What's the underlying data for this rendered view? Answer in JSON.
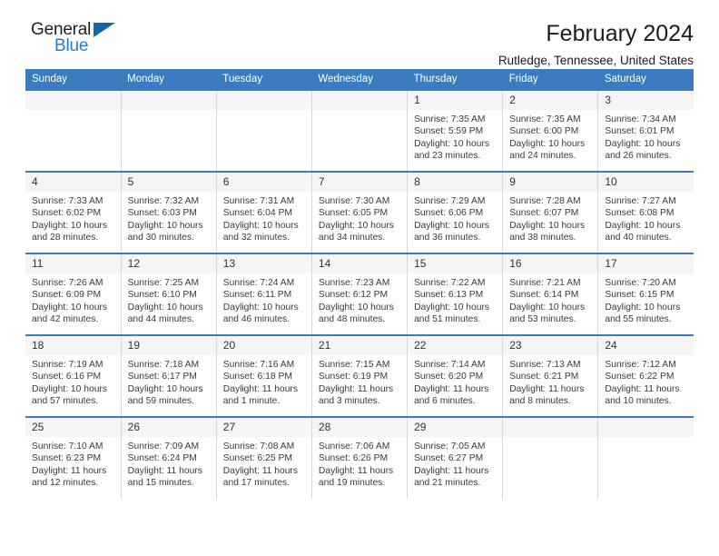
{
  "brand": {
    "word1": "General",
    "word2": "Blue",
    "triangle_color": "#1565a8",
    "blue_color": "#1f7fc6"
  },
  "header": {
    "title": "February 2024",
    "subtitle": "Rutledge, Tennessee, United States",
    "header_bg": "#3a7cbe"
  },
  "calendar": {
    "weekdays": [
      "Sunday",
      "Monday",
      "Tuesday",
      "Wednesday",
      "Thursday",
      "Friday",
      "Saturday"
    ],
    "weeks": [
      [
        {
          "day": "",
          "sunrise": "",
          "sunset": "",
          "daylight": "",
          "daylight2": ""
        },
        {
          "day": "",
          "sunrise": "",
          "sunset": "",
          "daylight": "",
          "daylight2": ""
        },
        {
          "day": "",
          "sunrise": "",
          "sunset": "",
          "daylight": "",
          "daylight2": ""
        },
        {
          "day": "",
          "sunrise": "",
          "sunset": "",
          "daylight": "",
          "daylight2": ""
        },
        {
          "day": "1",
          "sunrise": "Sunrise: 7:35 AM",
          "sunset": "Sunset: 5:59 PM",
          "daylight": "Daylight: 10 hours",
          "daylight2": "and 23 minutes."
        },
        {
          "day": "2",
          "sunrise": "Sunrise: 7:35 AM",
          "sunset": "Sunset: 6:00 PM",
          "daylight": "Daylight: 10 hours",
          "daylight2": "and 24 minutes."
        },
        {
          "day": "3",
          "sunrise": "Sunrise: 7:34 AM",
          "sunset": "Sunset: 6:01 PM",
          "daylight": "Daylight: 10 hours",
          "daylight2": "and 26 minutes."
        }
      ],
      [
        {
          "day": "4",
          "sunrise": "Sunrise: 7:33 AM",
          "sunset": "Sunset: 6:02 PM",
          "daylight": "Daylight: 10 hours",
          "daylight2": "and 28 minutes."
        },
        {
          "day": "5",
          "sunrise": "Sunrise: 7:32 AM",
          "sunset": "Sunset: 6:03 PM",
          "daylight": "Daylight: 10 hours",
          "daylight2": "and 30 minutes."
        },
        {
          "day": "6",
          "sunrise": "Sunrise: 7:31 AM",
          "sunset": "Sunset: 6:04 PM",
          "daylight": "Daylight: 10 hours",
          "daylight2": "and 32 minutes."
        },
        {
          "day": "7",
          "sunrise": "Sunrise: 7:30 AM",
          "sunset": "Sunset: 6:05 PM",
          "daylight": "Daylight: 10 hours",
          "daylight2": "and 34 minutes."
        },
        {
          "day": "8",
          "sunrise": "Sunrise: 7:29 AM",
          "sunset": "Sunset: 6:06 PM",
          "daylight": "Daylight: 10 hours",
          "daylight2": "and 36 minutes."
        },
        {
          "day": "9",
          "sunrise": "Sunrise: 7:28 AM",
          "sunset": "Sunset: 6:07 PM",
          "daylight": "Daylight: 10 hours",
          "daylight2": "and 38 minutes."
        },
        {
          "day": "10",
          "sunrise": "Sunrise: 7:27 AM",
          "sunset": "Sunset: 6:08 PM",
          "daylight": "Daylight: 10 hours",
          "daylight2": "and 40 minutes."
        }
      ],
      [
        {
          "day": "11",
          "sunrise": "Sunrise: 7:26 AM",
          "sunset": "Sunset: 6:09 PM",
          "daylight": "Daylight: 10 hours",
          "daylight2": "and 42 minutes."
        },
        {
          "day": "12",
          "sunrise": "Sunrise: 7:25 AM",
          "sunset": "Sunset: 6:10 PM",
          "daylight": "Daylight: 10 hours",
          "daylight2": "and 44 minutes."
        },
        {
          "day": "13",
          "sunrise": "Sunrise: 7:24 AM",
          "sunset": "Sunset: 6:11 PM",
          "daylight": "Daylight: 10 hours",
          "daylight2": "and 46 minutes."
        },
        {
          "day": "14",
          "sunrise": "Sunrise: 7:23 AM",
          "sunset": "Sunset: 6:12 PM",
          "daylight": "Daylight: 10 hours",
          "daylight2": "and 48 minutes."
        },
        {
          "day": "15",
          "sunrise": "Sunrise: 7:22 AM",
          "sunset": "Sunset: 6:13 PM",
          "daylight": "Daylight: 10 hours",
          "daylight2": "and 51 minutes."
        },
        {
          "day": "16",
          "sunrise": "Sunrise: 7:21 AM",
          "sunset": "Sunset: 6:14 PM",
          "daylight": "Daylight: 10 hours",
          "daylight2": "and 53 minutes."
        },
        {
          "day": "17",
          "sunrise": "Sunrise: 7:20 AM",
          "sunset": "Sunset: 6:15 PM",
          "daylight": "Daylight: 10 hours",
          "daylight2": "and 55 minutes."
        }
      ],
      [
        {
          "day": "18",
          "sunrise": "Sunrise: 7:19 AM",
          "sunset": "Sunset: 6:16 PM",
          "daylight": "Daylight: 10 hours",
          "daylight2": "and 57 minutes."
        },
        {
          "day": "19",
          "sunrise": "Sunrise: 7:18 AM",
          "sunset": "Sunset: 6:17 PM",
          "daylight": "Daylight: 10 hours",
          "daylight2": "and 59 minutes."
        },
        {
          "day": "20",
          "sunrise": "Sunrise: 7:16 AM",
          "sunset": "Sunset: 6:18 PM",
          "daylight": "Daylight: 11 hours",
          "daylight2": "and 1 minute."
        },
        {
          "day": "21",
          "sunrise": "Sunrise: 7:15 AM",
          "sunset": "Sunset: 6:19 PM",
          "daylight": "Daylight: 11 hours",
          "daylight2": "and 3 minutes."
        },
        {
          "day": "22",
          "sunrise": "Sunrise: 7:14 AM",
          "sunset": "Sunset: 6:20 PM",
          "daylight": "Daylight: 11 hours",
          "daylight2": "and 6 minutes."
        },
        {
          "day": "23",
          "sunrise": "Sunrise: 7:13 AM",
          "sunset": "Sunset: 6:21 PM",
          "daylight": "Daylight: 11 hours",
          "daylight2": "and 8 minutes."
        },
        {
          "day": "24",
          "sunrise": "Sunrise: 7:12 AM",
          "sunset": "Sunset: 6:22 PM",
          "daylight": "Daylight: 11 hours",
          "daylight2": "and 10 minutes."
        }
      ],
      [
        {
          "day": "25",
          "sunrise": "Sunrise: 7:10 AM",
          "sunset": "Sunset: 6:23 PM",
          "daylight": "Daylight: 11 hours",
          "daylight2": "and 12 minutes."
        },
        {
          "day": "26",
          "sunrise": "Sunrise: 7:09 AM",
          "sunset": "Sunset: 6:24 PM",
          "daylight": "Daylight: 11 hours",
          "daylight2": "and 15 minutes."
        },
        {
          "day": "27",
          "sunrise": "Sunrise: 7:08 AM",
          "sunset": "Sunset: 6:25 PM",
          "daylight": "Daylight: 11 hours",
          "daylight2": "and 17 minutes."
        },
        {
          "day": "28",
          "sunrise": "Sunrise: 7:06 AM",
          "sunset": "Sunset: 6:26 PM",
          "daylight": "Daylight: 11 hours",
          "daylight2": "and 19 minutes."
        },
        {
          "day": "29",
          "sunrise": "Sunrise: 7:05 AM",
          "sunset": "Sunset: 6:27 PM",
          "daylight": "Daylight: 11 hours",
          "daylight2": "and 21 minutes."
        },
        {
          "day": "",
          "sunrise": "",
          "sunset": "",
          "daylight": "",
          "daylight2": ""
        },
        {
          "day": "",
          "sunrise": "",
          "sunset": "",
          "daylight": "",
          "daylight2": ""
        }
      ]
    ]
  }
}
